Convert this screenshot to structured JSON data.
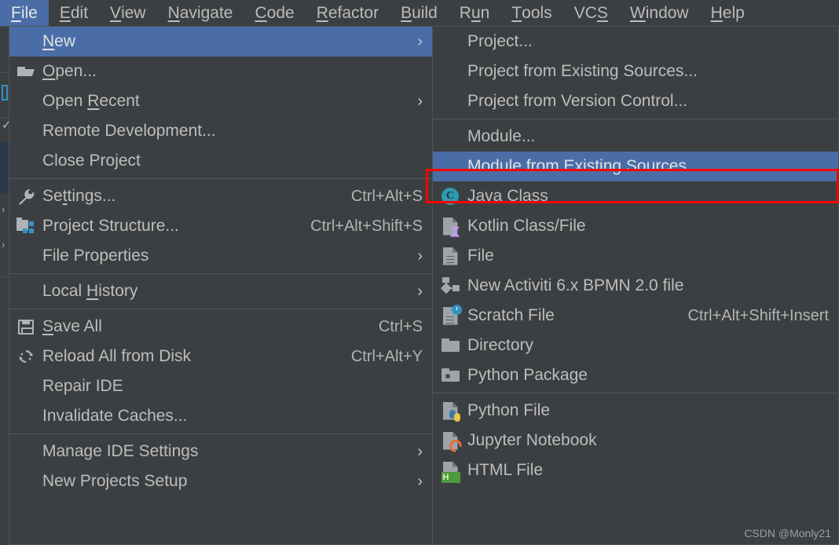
{
  "app": {
    "watermark": "CSDN @Monly21"
  },
  "menubar": {
    "items": [
      {
        "label": "File",
        "pre": "",
        "mn": "F",
        "post": "ile",
        "active": true
      },
      {
        "label": "Edit",
        "pre": "",
        "mn": "E",
        "post": "dit",
        "active": false
      },
      {
        "label": "View",
        "pre": "",
        "mn": "V",
        "post": "iew",
        "active": false
      },
      {
        "label": "Navigate",
        "pre": "",
        "mn": "N",
        "post": "avigate",
        "active": false
      },
      {
        "label": "Code",
        "pre": "",
        "mn": "C",
        "post": "ode",
        "active": false
      },
      {
        "label": "Refactor",
        "pre": "",
        "mn": "R",
        "post": "efactor",
        "active": false
      },
      {
        "label": "Build",
        "pre": "",
        "mn": "B",
        "post": "uild",
        "active": false
      },
      {
        "label": "Run",
        "pre": "R",
        "mn": "u",
        "post": "n",
        "active": false
      },
      {
        "label": "Tools",
        "pre": "",
        "mn": "T",
        "post": "ools",
        "active": false
      },
      {
        "label": "VCS",
        "pre": "VC",
        "mn": "S",
        "post": "",
        "active": false
      },
      {
        "label": "Window",
        "pre": "",
        "mn": "W",
        "post": "indow",
        "active": false
      },
      {
        "label": "Help",
        "pre": "",
        "mn": "H",
        "post": "elp",
        "active": false
      }
    ]
  },
  "file_menu": {
    "items": [
      {
        "id": "new",
        "pre": "",
        "mn": "N",
        "post": "ew",
        "icon": "",
        "accel": "",
        "arrow": "›",
        "selected": true
      },
      {
        "id": "open",
        "pre": "",
        "mn": "O",
        "post": "pen...",
        "icon": "folder-open",
        "accel": "",
        "arrow": "",
        "selected": false
      },
      {
        "id": "open-recent",
        "pre": "Open ",
        "mn": "R",
        "post": "ecent",
        "icon": "",
        "accel": "",
        "arrow": "›",
        "selected": false
      },
      {
        "id": "remote-dev",
        "pre": "Remote Development...",
        "mn": "",
        "post": "",
        "icon": "",
        "accel": "",
        "arrow": "",
        "selected": false
      },
      {
        "id": "close-project",
        "pre": "Close Project",
        "mn": "",
        "post": "",
        "icon": "",
        "accel": "",
        "arrow": "",
        "selected": false
      },
      {
        "id": "sep1",
        "separator": true
      },
      {
        "id": "settings",
        "pre": "Se",
        "mn": "t",
        "post": "tings...",
        "icon": "wrench",
        "accel": "Ctrl+Alt+S",
        "arrow": "",
        "selected": false
      },
      {
        "id": "project-struct",
        "pre": "Project Structure...",
        "mn": "",
        "post": "",
        "icon": "proj-struct",
        "accel": "Ctrl+Alt+Shift+S",
        "arrow": "",
        "selected": false
      },
      {
        "id": "file-props",
        "pre": "File Properties",
        "mn": "",
        "post": "",
        "icon": "",
        "accel": "",
        "arrow": "›",
        "selected": false
      },
      {
        "id": "sep2",
        "separator": true
      },
      {
        "id": "local-history",
        "pre": "Local ",
        "mn": "H",
        "post": "istory",
        "icon": "",
        "accel": "",
        "arrow": "›",
        "selected": false
      },
      {
        "id": "sep3",
        "separator": true
      },
      {
        "id": "save-all",
        "pre": "",
        "mn": "S",
        "post": "ave All",
        "icon": "save",
        "accel": "Ctrl+S",
        "arrow": "",
        "selected": false
      },
      {
        "id": "reload-all",
        "pre": "Reload All from Disk",
        "mn": "",
        "post": "",
        "icon": "reload",
        "accel": "Ctrl+Alt+Y",
        "arrow": "",
        "selected": false
      },
      {
        "id": "repair-ide",
        "pre": "Repair IDE",
        "mn": "",
        "post": "",
        "icon": "",
        "accel": "",
        "arrow": "",
        "selected": false
      },
      {
        "id": "invalidate",
        "pre": "Invalidate Caches...",
        "mn": "",
        "post": "",
        "icon": "",
        "accel": "",
        "arrow": "",
        "selected": false
      },
      {
        "id": "sep4",
        "separator": true
      },
      {
        "id": "manage-ide",
        "pre": "Manage IDE Settings",
        "mn": "",
        "post": "",
        "icon": "",
        "accel": "",
        "arrow": "›",
        "selected": false
      },
      {
        "id": "new-proj-setup",
        "pre": "New Projects Setup",
        "mn": "",
        "post": "",
        "icon": "",
        "accel": "",
        "arrow": "›",
        "selected": false
      }
    ]
  },
  "new_submenu": {
    "items": [
      {
        "id": "project",
        "label": "Project...",
        "icon": "",
        "accel": "",
        "selected": false
      },
      {
        "id": "project-existing",
        "label": "Project from Existing Sources...",
        "icon": "",
        "accel": "",
        "selected": false
      },
      {
        "id": "project-vcs",
        "label": "Project from Version Control...",
        "icon": "",
        "accel": "",
        "selected": false
      },
      {
        "id": "sep1",
        "separator": true
      },
      {
        "id": "module",
        "label": "Module...",
        "icon": "",
        "accel": "",
        "selected": false
      },
      {
        "id": "module-existing",
        "label": "Module from Existing Sources...",
        "icon": "",
        "accel": "",
        "selected": true,
        "annotated": true
      },
      {
        "id": "java-class",
        "label": "Java Class",
        "icon": "java-class",
        "accel": "",
        "selected": false
      },
      {
        "id": "kotlin-class",
        "label": "Kotlin Class/File",
        "icon": "kotlin",
        "accel": "",
        "selected": false
      },
      {
        "id": "file",
        "label": "File",
        "icon": "file",
        "accel": "",
        "selected": false
      },
      {
        "id": "activiti-bpmn",
        "label": "New Activiti 6.x BPMN 2.0 file",
        "icon": "bpmn",
        "accel": "",
        "selected": false
      },
      {
        "id": "scratch-file",
        "label": "Scratch File",
        "icon": "scratch",
        "accel": "Ctrl+Alt+Shift+Insert",
        "selected": false
      },
      {
        "id": "directory",
        "label": "Directory",
        "icon": "directory",
        "accel": "",
        "selected": false
      },
      {
        "id": "python-package",
        "label": "Python Package",
        "icon": "py-package",
        "accel": "",
        "selected": false
      },
      {
        "id": "sep2",
        "separator": true
      },
      {
        "id": "python-file",
        "label": "Python File",
        "icon": "py-file",
        "accel": "",
        "selected": false
      },
      {
        "id": "jupyter-notebook",
        "label": "Jupyter Notebook",
        "icon": "jupyter",
        "accel": "",
        "selected": false
      },
      {
        "id": "html-file",
        "label": "HTML File",
        "icon": "html",
        "accel": "",
        "selected": false
      }
    ]
  },
  "colors": {
    "menu_bg": "#3c3f41",
    "selection": "#4a6da7",
    "text": "#bdbdbd",
    "separator": "#54585a",
    "annotation": "#ff0000"
  }
}
